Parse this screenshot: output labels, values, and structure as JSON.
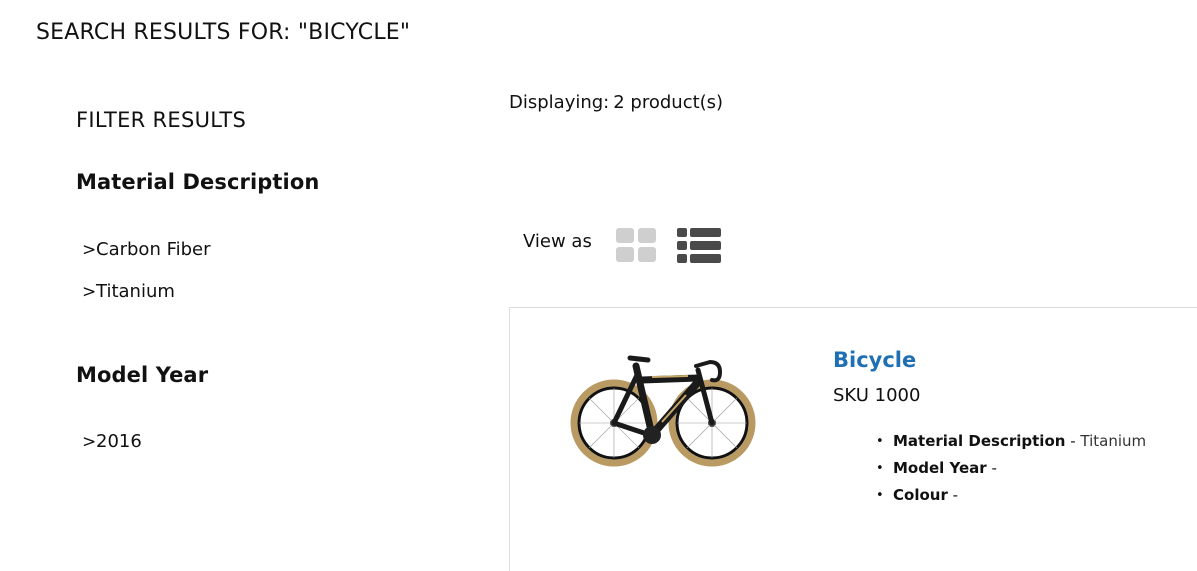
{
  "page_title": "SEARCH RESULTS FOR: \"BICYCLE\"",
  "sidebar": {
    "heading": "FILTER RESULTS",
    "facets": [
      {
        "title": "Material Description",
        "options": [
          {
            "label": "Carbon Fiber"
          },
          {
            "label": "Titanium"
          }
        ]
      },
      {
        "title": "Model Year",
        "options": [
          {
            "label": "2016"
          }
        ]
      }
    ],
    "chevron": ">"
  },
  "results": {
    "displaying_label": "Displaying:",
    "displaying_count": "2 product(s)",
    "view_as_label": "View as",
    "view_modes": [
      {
        "name": "grid",
        "icon": "grid-icon",
        "active": false
      },
      {
        "name": "list",
        "icon": "list-icon",
        "active": true
      }
    ],
    "products": [
      {
        "name": "Bicycle",
        "sku": "SKU 1000",
        "image_icon": "bicycle-image",
        "attributes": [
          {
            "name": "Material Description",
            "sep": " - ",
            "value": "Titanium"
          },
          {
            "name": "Model Year",
            "sep": " -",
            "value": ""
          },
          {
            "name": "Colour",
            "sep": " -",
            "value": ""
          }
        ]
      }
    ]
  },
  "colors": {
    "link": "#1f6fb5",
    "icon_active": "#4a4a4a",
    "icon_inactive": "#cfcfcf",
    "card_border": "#dcdcdc"
  }
}
